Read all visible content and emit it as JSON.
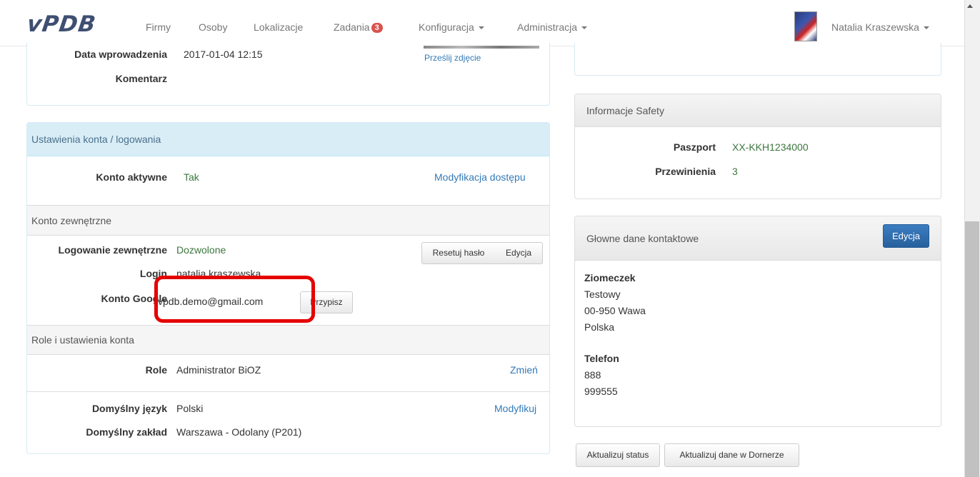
{
  "navbar": {
    "brand": "vPDB",
    "items": {
      "firmy": "Firmy",
      "osoby": "Osoby",
      "lokalizacje": "Lokalizacje",
      "zadania": "Zadania",
      "zadania_badge": "3",
      "konfiguracja": "Konfiguracja",
      "administracja": "Administracja"
    },
    "user": "Natalia Kraszewska"
  },
  "info_panel": {
    "data_wprowadzenia_label": "Data wprowadzenia",
    "data_wprowadzenia_value": "2017-01-04 12:15",
    "komentarz_label": "Komentarz",
    "photo_link": "Prześlij zdjęcie"
  },
  "account_panel": {
    "heading": "Ustawienia konta / logowania",
    "konto_aktywne_label": "Konto aktywne",
    "konto_aktywne_value": "Tak",
    "modyfikacja_link": "Modyfikacja dostępu",
    "external_section": "Konto zewnętrzne",
    "logowanie_label": "Logowanie zewnętrzne",
    "logowanie_value": "Dozwolone",
    "reset_button": "Resetuj hasło",
    "edit_button": "Edycja",
    "login_label": "Login",
    "login_value": "natalia.kraszewska",
    "google_label": "Konto Google",
    "google_value": "vpdb.demo@gmail.com",
    "assign_button": "Przypisz",
    "roles_section": "Role i ustawienia konta",
    "role_label": "Role",
    "role_value": "Administrator BiOZ",
    "role_change_link": "Zmień",
    "lang_label": "Domyślny język",
    "lang_value": "Polski",
    "lang_modify_link": "Modyfikuj",
    "plant_label": "Domyślny zakład",
    "plant_value": "Warszawa - Odolany (P201)"
  },
  "safety_panel": {
    "heading": "Informacje Safety",
    "paszport_label": "Paszport",
    "paszport_value": "XX-KKH1234000",
    "przewinienia_label": "Przewinienia",
    "przewinienia_value": "3"
  },
  "contact_panel": {
    "heading": "Głowne dane kontaktowe",
    "edit_button": "Edycja",
    "name": "Ziomeczek",
    "street": "Testowy",
    "postal": "00-950 Wawa",
    "country": "Polska",
    "phone_label": "Telefon",
    "phone_1": "888",
    "phone_2": "999555"
  },
  "bottom_buttons": {
    "update_status": "Aktualizuj status",
    "update_dornerze": "Aktualizuj dane w Dornerze"
  }
}
